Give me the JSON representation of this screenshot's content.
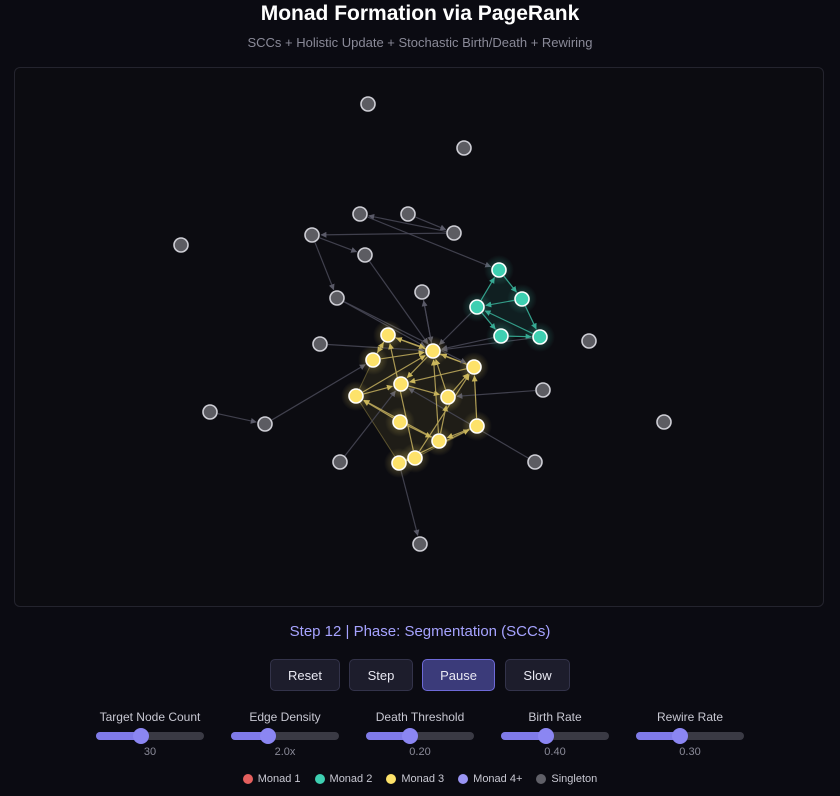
{
  "header": {
    "title": "Monad Formation via PageRank",
    "subtitle": "SCCs + Holistic Update + Stochastic Birth/Death + Rewiring"
  },
  "status": "Step 12 | Phase: Segmentation (SCCs)",
  "buttons": [
    {
      "label": "Reset",
      "active": false
    },
    {
      "label": "Step",
      "active": false
    },
    {
      "label": "Pause",
      "active": true
    },
    {
      "label": "Slow",
      "active": false
    }
  ],
  "sliders": [
    {
      "label": "Target Node Count",
      "value": "30",
      "fraction": 0.42
    },
    {
      "label": "Edge Density",
      "value": "2.0x",
      "fraction": 0.34
    },
    {
      "label": "Death Threshold",
      "value": "0.20",
      "fraction": 0.41
    },
    {
      "label": "Birth Rate",
      "value": "0.40",
      "fraction": 0.42
    },
    {
      "label": "Rewire Rate",
      "value": "0.30",
      "fraction": 0.41
    }
  ],
  "legend": [
    {
      "label": "Monad 1",
      "color": "#e5605e"
    },
    {
      "label": "Monad 2",
      "color": "#3ecfb1"
    },
    {
      "label": "Monad 3",
      "color": "#fde26a"
    },
    {
      "label": "Monad 4+",
      "color": "#9a95f4"
    },
    {
      "label": "Singleton",
      "color": "#606068"
    }
  ],
  "colors": {
    "monad2": "#3ecfb1",
    "monad3": "#fde26a",
    "singleton": "#5c5c62",
    "edge": "#4a4a58",
    "accent": "#7f7ae8"
  },
  "graph": {
    "nodes": [
      {
        "id": "s1",
        "group": "singleton"
      },
      {
        "id": "s2",
        "group": "singleton"
      },
      {
        "id": "s3",
        "group": "singleton"
      },
      {
        "id": "s4",
        "group": "singleton"
      },
      {
        "id": "s5",
        "group": "singleton"
      },
      {
        "id": "s6",
        "group": "singleton"
      },
      {
        "id": "s7",
        "group": "singleton"
      },
      {
        "id": "s8",
        "group": "singleton"
      },
      {
        "id": "s9",
        "group": "singleton"
      },
      {
        "id": "s10",
        "group": "singleton"
      },
      {
        "id": "s11",
        "group": "singleton"
      },
      {
        "id": "s12",
        "group": "singleton"
      },
      {
        "id": "s13",
        "group": "singleton"
      },
      {
        "id": "s14",
        "group": "singleton"
      },
      {
        "id": "s15",
        "group": "singleton"
      },
      {
        "id": "s16",
        "group": "singleton"
      },
      {
        "id": "s17",
        "group": "singleton"
      },
      {
        "id": "s18",
        "group": "singleton"
      },
      {
        "id": "s19",
        "group": "singleton"
      },
      {
        "id": "t1",
        "group": "monad2"
      },
      {
        "id": "t2",
        "group": "monad2"
      },
      {
        "id": "t3",
        "group": "monad2"
      },
      {
        "id": "t4",
        "group": "monad2"
      },
      {
        "id": "t5",
        "group": "monad2"
      },
      {
        "id": "y1",
        "group": "monad3"
      },
      {
        "id": "y2",
        "group": "monad3"
      },
      {
        "id": "y3",
        "group": "monad3"
      },
      {
        "id": "y4",
        "group": "monad3"
      },
      {
        "id": "y5",
        "group": "monad3"
      },
      {
        "id": "y6",
        "group": "monad3"
      },
      {
        "id": "y7",
        "group": "monad3"
      },
      {
        "id": "y8",
        "group": "monad3"
      },
      {
        "id": "y9",
        "group": "monad3"
      },
      {
        "id": "y10",
        "group": "monad3"
      },
      {
        "id": "y11",
        "group": "monad3"
      },
      {
        "id": "y12",
        "group": "monad3"
      }
    ],
    "edges": [
      [
        "s16",
        "s9"
      ],
      [
        "s9",
        "s10"
      ],
      [
        "s11",
        "s14"
      ],
      [
        "s11",
        "s12"
      ],
      [
        "s9",
        "s11"
      ],
      [
        "s12",
        "y2"
      ],
      [
        "s14",
        "y2"
      ],
      [
        "s13",
        "y2"
      ],
      [
        "s15",
        "y2"
      ],
      [
        "s10",
        "t1"
      ],
      [
        "t1",
        "t2"
      ],
      [
        "t2",
        "t5"
      ],
      [
        "t2",
        "t3"
      ],
      [
        "t3",
        "t4"
      ],
      [
        "t4",
        "t5"
      ],
      [
        "t5",
        "t3"
      ],
      [
        "t3",
        "t1"
      ],
      [
        "t4",
        "y2"
      ],
      [
        "t3",
        "y2"
      ],
      [
        "t5",
        "y2"
      ],
      [
        "s5",
        "y5"
      ],
      [
        "s6",
        "y5"
      ],
      [
        "s8",
        "y6"
      ],
      [
        "s3",
        "s4"
      ],
      [
        "s4",
        "y4"
      ],
      [
        "y11",
        "s7"
      ],
      [
        "y6",
        "y3"
      ],
      [
        "y1",
        "y4"
      ],
      [
        "y3",
        "y2"
      ],
      [
        "y4",
        "y2"
      ],
      [
        "y1",
        "y2"
      ],
      [
        "y4",
        "y1"
      ],
      [
        "y2",
        "y5"
      ],
      [
        "y5",
        "y6"
      ],
      [
        "y3",
        "y5"
      ],
      [
        "y7",
        "y5"
      ],
      [
        "y7",
        "y2"
      ],
      [
        "y8",
        "y3"
      ],
      [
        "y9",
        "y7"
      ],
      [
        "y10",
        "y7"
      ],
      [
        "y11",
        "y8"
      ],
      [
        "y11",
        "y12"
      ],
      [
        "y12",
        "y3"
      ],
      [
        "y12",
        "y1"
      ],
      [
        "y10",
        "y6"
      ],
      [
        "y9",
        "y10"
      ],
      [
        "y8",
        "y10"
      ],
      [
        "y10",
        "y2"
      ],
      [
        "y3",
        "y1"
      ],
      [
        "y6",
        "y2"
      ],
      [
        "s12",
        "y3"
      ],
      [
        "y2",
        "s13"
      ]
    ]
  }
}
